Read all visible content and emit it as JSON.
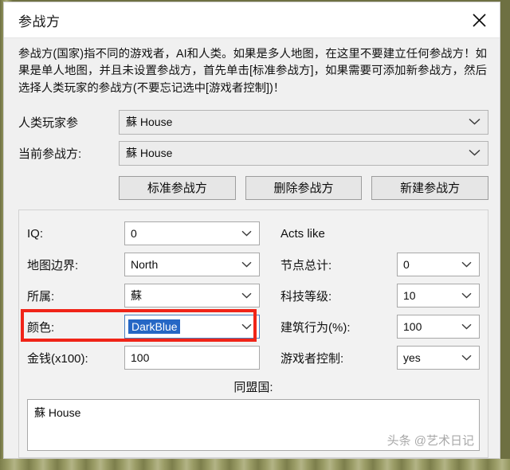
{
  "window": {
    "title": "参战方",
    "close_icon": "close-icon"
  },
  "description": "参战方(国家)指不同的游戏者，AI和人类。如果是多人地图，在这里不要建立任何参战方！如果是单人地图，并且未设置参战方，首先单击[标准参战方]，如果需要可添加新参战方，然后选择人类玩家的参战方(不要忘记选中[游戏者控制])！",
  "selectors": [
    {
      "label": "人类玩家参",
      "value": "蘇 House"
    },
    {
      "label": "当前参战方:",
      "value": "蘇 House"
    }
  ],
  "buttons": [
    {
      "label": "标准参战方"
    },
    {
      "label": "删除参战方"
    },
    {
      "label": "新建参战方"
    }
  ],
  "fields": {
    "iq": {
      "label": "IQ:",
      "value": "0"
    },
    "acts_like": {
      "label": "Acts like"
    },
    "map_border": {
      "label": "地图边界:",
      "value": "North"
    },
    "node_total": {
      "label": "节点总计:",
      "value": "0"
    },
    "belongs_to": {
      "label": "所属:",
      "value": "蘇"
    },
    "tech_level": {
      "label": "科技等级:",
      "value": "10"
    },
    "color": {
      "label": "颜色:",
      "value": "DarkBlue"
    },
    "build_behavior": {
      "label": "建筑行为(%):",
      "value": "100"
    },
    "money": {
      "label": "金钱(x100):",
      "value": "100"
    },
    "player_control": {
      "label": "游戏者控制:",
      "value": "yes"
    }
  },
  "allies": {
    "label": "同盟国:",
    "items": [
      "蘇 House"
    ]
  },
  "watermark": "头条 @艺术日记",
  "colors": {
    "highlight_box": "#f02418",
    "selection_blue": "#2567c5",
    "window_bg": "#f0f0f0",
    "field_bg": "#ffffff",
    "backdrop": "#8a8c57"
  }
}
